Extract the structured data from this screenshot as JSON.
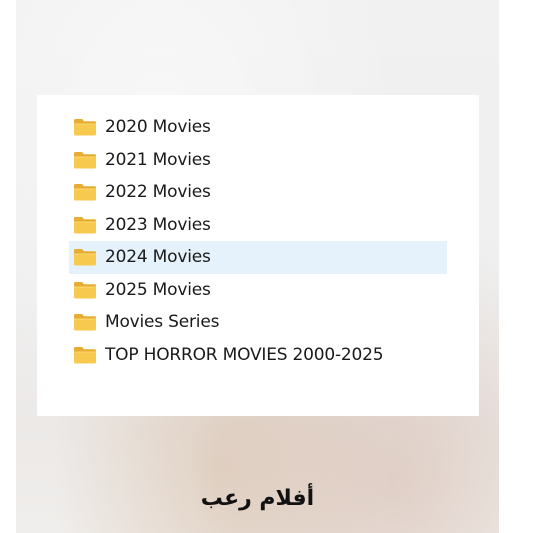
{
  "folders": [
    {
      "label": "2020 Movies",
      "icon": "folder-icon",
      "selected": false
    },
    {
      "label": "2021 Movies",
      "icon": "folder-icon",
      "selected": false
    },
    {
      "label": "2022 Movies",
      "icon": "folder-icon",
      "selected": false
    },
    {
      "label": "2023 Movies",
      "icon": "folder-icon",
      "selected": false
    },
    {
      "label": "2024 Movies",
      "icon": "folder-icon",
      "selected": true
    },
    {
      "label": "2025 Movies",
      "icon": "folder-icon",
      "selected": false
    },
    {
      "label": "Movies Series",
      "icon": "folder-icon",
      "selected": false
    },
    {
      "label": "TOP HORROR MOVIES 2000-2025",
      "icon": "folder-icon",
      "selected": false
    }
  ],
  "caption": "أفلام رعب",
  "colors": {
    "selection": "#e5f1fb",
    "folder_front": "#f8c94f",
    "folder_back": "#eab43a"
  }
}
